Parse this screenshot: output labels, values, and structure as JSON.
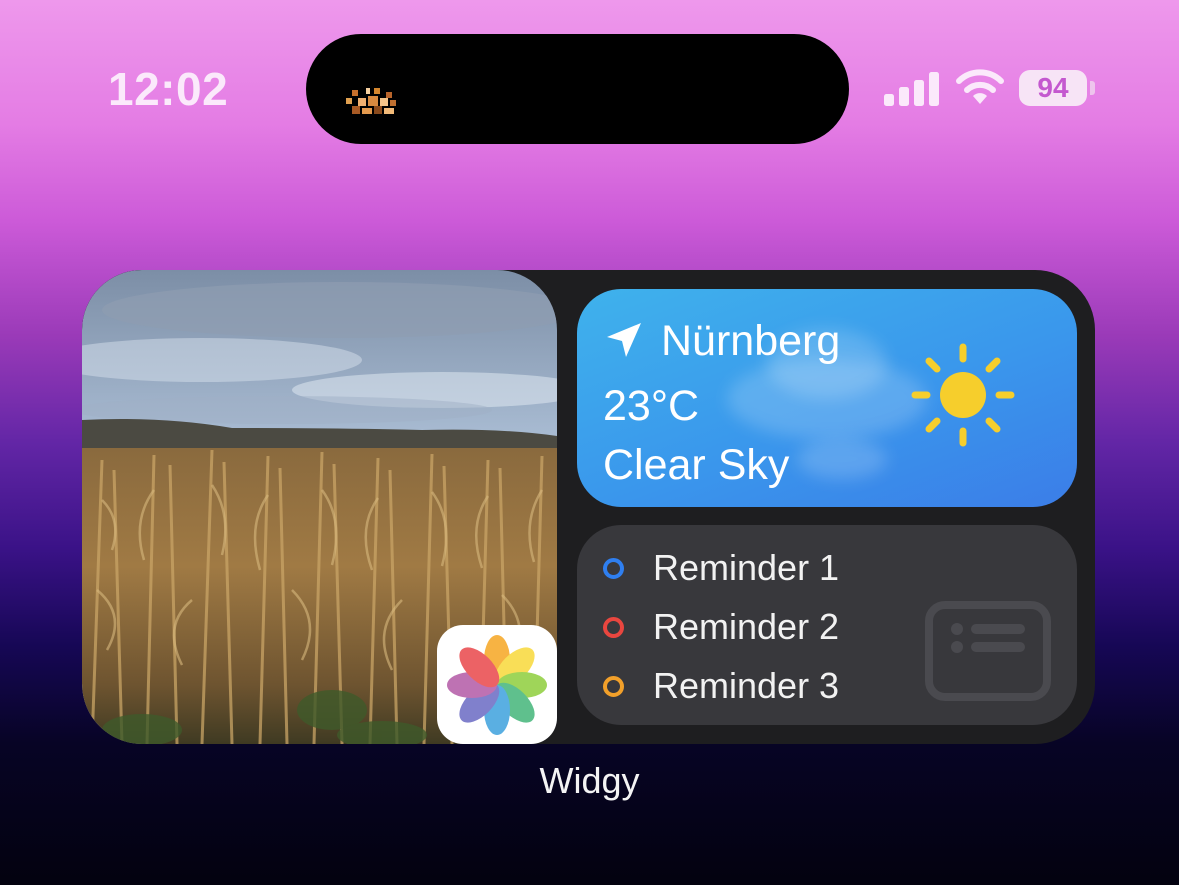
{
  "status_bar": {
    "time": "12:02",
    "battery_level": "94",
    "signal_icon": "cellular-signal-icon",
    "wifi_icon": "wifi-icon",
    "island_activity_icon": "pixel-app-icon"
  },
  "widget": {
    "photo_icon": "photos-app-icon",
    "weather": {
      "location_icon": "location-arrow-icon",
      "city": "Nürnberg",
      "temperature": "23°C",
      "condition": "Clear Sky",
      "condition_icon": "sun-icon",
      "gradient_top": "#3fb2ec",
      "gradient_bottom": "#3b7de8"
    },
    "reminders": [
      {
        "label": "Reminder 1",
        "color": "#2f7ff0"
      },
      {
        "label": "Reminder 2",
        "color": "#e9463f"
      },
      {
        "label": "Reminder 3",
        "color": "#f2a02a"
      }
    ],
    "reminders_icon": "list-card-icon"
  },
  "widget_name": "Widgy"
}
